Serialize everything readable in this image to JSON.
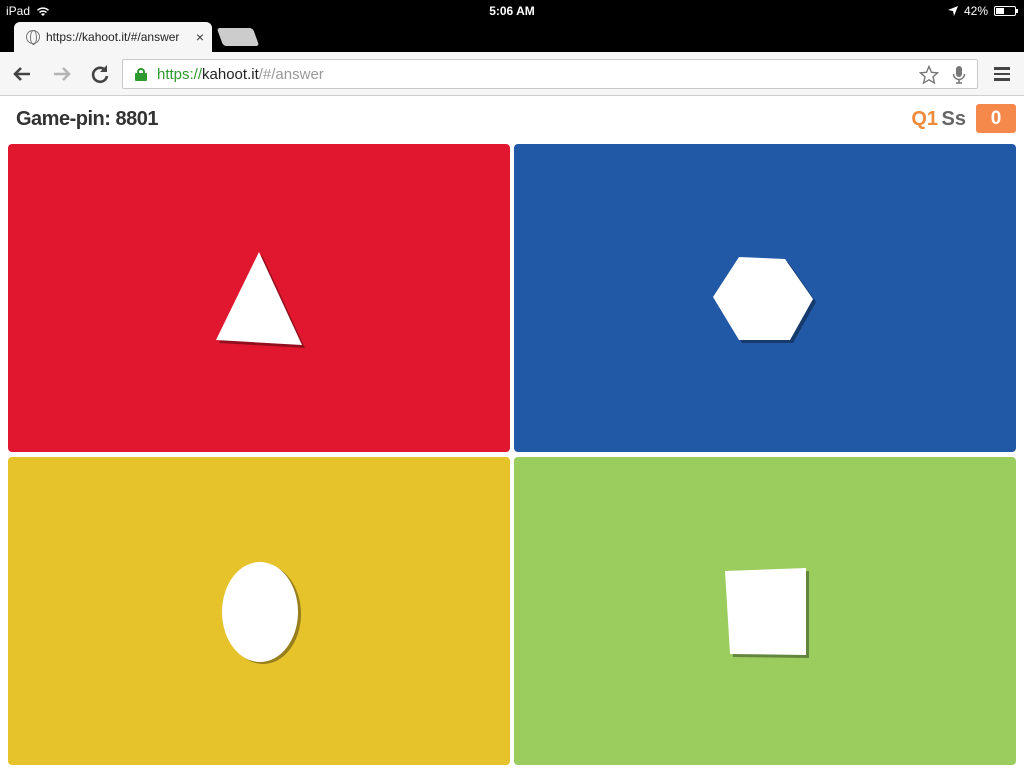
{
  "status_bar": {
    "device": "iPad",
    "time": "5:06 AM",
    "battery": "42%",
    "battery_level": 0.42
  },
  "browser": {
    "tab_title": "https://kahoot.it/#/answer",
    "tab_close": "×",
    "url_scheme": "https://",
    "url_host": "kahoot.it",
    "url_path": "/#/answer"
  },
  "game": {
    "pin_label": "Game-pin: 8801",
    "question": "Q1",
    "nickname": "Ss",
    "score": "0"
  },
  "answers": [
    {
      "shape": "triangle",
      "color": "#e0172f"
    },
    {
      "shape": "hexagon",
      "color": "#2259a6"
    },
    {
      "shape": "circle",
      "color": "#e6c32b"
    },
    {
      "shape": "square",
      "color": "#9acd5e"
    }
  ],
  "colors": {
    "accent_orange": "#f5894c",
    "question_orange": "#f08a3c",
    "secure_green": "#2e9a2e"
  }
}
